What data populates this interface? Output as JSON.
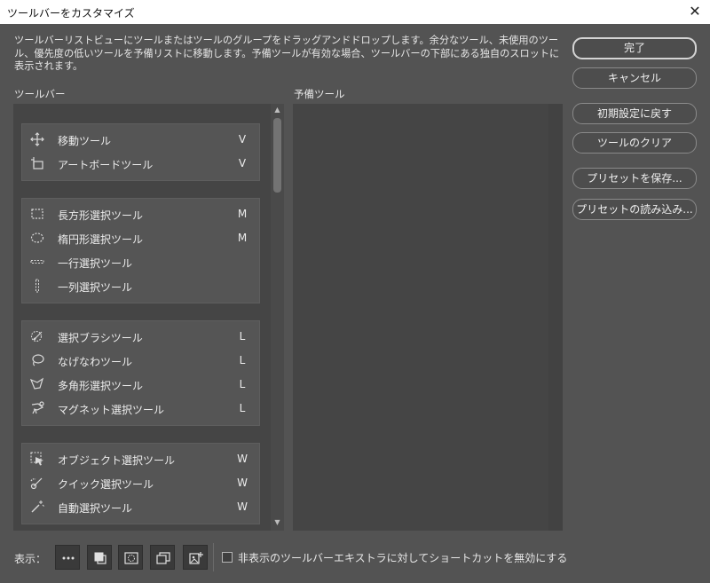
{
  "window": {
    "title": "ツールバーをカスタマイズ",
    "close_glyph": "✕"
  },
  "description": "ツールバーリストビューにツールまたはツールのグループをドラッグアンドドロップします。余分なツール、未使用のツール、優先度の低いツールを予備リストに移動します。予備ツールが有効な場合、ツールバーの下部にある独自のスロットに表示されます。",
  "toolbar_header": "ツールバー",
  "reserve_header": "予備ツール",
  "groups": [
    {
      "tools": [
        {
          "name": "移動ツール",
          "key": "V",
          "icon": "move-icon"
        },
        {
          "name": "アートボードツール",
          "key": "V",
          "icon": "artboard-icon"
        }
      ]
    },
    {
      "tools": [
        {
          "name": "長方形選択ツール",
          "key": "M",
          "icon": "rectangular-marquee-icon"
        },
        {
          "name": "楕円形選択ツール",
          "key": "M",
          "icon": "elliptical-marquee-icon"
        },
        {
          "name": "一行選択ツール",
          "key": "",
          "icon": "single-row-marquee-icon"
        },
        {
          "name": "一列選択ツール",
          "key": "",
          "icon": "single-column-marquee-icon"
        }
      ]
    },
    {
      "tools": [
        {
          "name": "選択ブラシツール",
          "key": "L",
          "icon": "selection-brush-icon"
        },
        {
          "name": "なげなわツール",
          "key": "L",
          "icon": "lasso-icon"
        },
        {
          "name": "多角形選択ツール",
          "key": "L",
          "icon": "polygonal-lasso-icon"
        },
        {
          "name": "マグネット選択ツール",
          "key": "L",
          "icon": "magnetic-lasso-icon"
        }
      ]
    },
    {
      "tools": [
        {
          "name": "オブジェクト選択ツール",
          "key": "W",
          "icon": "object-selection-icon"
        },
        {
          "name": "クイック選択ツール",
          "key": "W",
          "icon": "quick-selection-icon"
        },
        {
          "name": "自動選択ツール",
          "key": "W",
          "icon": "magic-wand-icon"
        }
      ]
    }
  ],
  "buttons": {
    "done": "完了",
    "cancel": "キャンセル",
    "restore_defaults": "初期設定に戻す",
    "clear_tools": "ツールのクリア",
    "save_preset": "プリセットを保存...",
    "load_preset": "プリセットの読み込み..."
  },
  "footer": {
    "show_label": "表示：",
    "checkbox_label": "非表示のツールバーエキストラに対してショートカットを無効にする",
    "checkbox_checked": false,
    "toggle_icons": [
      "more-icon",
      "foreground-background-color-icon",
      "quick-mask-icon",
      "screen-mode-icon",
      "edit-toolbar-icon"
    ]
  }
}
